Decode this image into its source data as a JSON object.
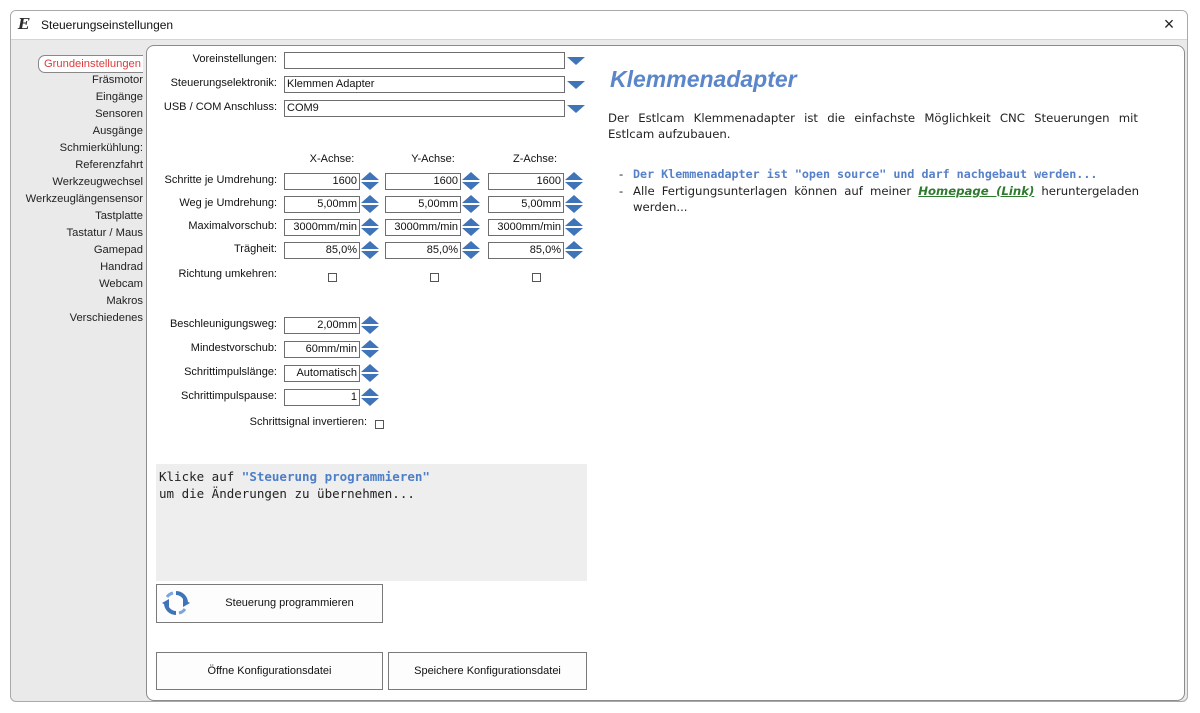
{
  "window": {
    "title": "Steuerungseinstellungen",
    "close_label": "×"
  },
  "sidebar": {
    "items": [
      {
        "label": "Grundeinstellungen",
        "active": true
      },
      {
        "label": "Fräsmotor"
      },
      {
        "label": "Eingänge"
      },
      {
        "label": "Sensoren"
      },
      {
        "label": "Ausgänge"
      },
      {
        "label": "Schmierkühlung:"
      },
      {
        "label": "Referenzfahrt"
      },
      {
        "label": "Werkzeugwechsel"
      },
      {
        "label": "Werkzeuglängensensor"
      },
      {
        "label": "Tastplatte"
      },
      {
        "label": "Tastatur / Maus"
      },
      {
        "label": "Gamepad"
      },
      {
        "label": "Handrad"
      },
      {
        "label": "Webcam"
      },
      {
        "label": "Makros"
      },
      {
        "label": "Verschiedenes"
      }
    ]
  },
  "top": {
    "voreinstellungen_label": "Voreinstellungen:",
    "voreinstellungen_value": "",
    "elektronik_label": "Steuerungselektronik:",
    "elektronik_value": "Klemmen Adapter",
    "usb_label": "USB / COM Anschluss:",
    "usb_value": "COM9"
  },
  "axes": {
    "headers": [
      "X-Achse:",
      "Y-Achse:",
      "Z-Achse:"
    ],
    "rows": [
      {
        "label": "Schritte je Umdrehung:",
        "values": [
          "1600",
          "1600",
          "1600"
        ]
      },
      {
        "label": "Weg je Umdrehung:",
        "values": [
          "5,00mm",
          "5,00mm",
          "5,00mm"
        ]
      },
      {
        "label": "Maximalvorschub:",
        "values": [
          "3000mm/min",
          "3000mm/min",
          "3000mm/min"
        ]
      },
      {
        "label": "Trägheit:",
        "values": [
          "85,0%",
          "85,0%",
          "85,0%"
        ]
      }
    ],
    "richtung_label": "Richtung umkehren:"
  },
  "extra": {
    "beschleunigung_label": "Beschleunigungsweg:",
    "beschleunigung_value": "2,00mm",
    "mindestvorschub_label": "Mindestvorschub:",
    "mindestvorschub_value": "60mm/min",
    "impulslaenge_label": "Schrittimpulslänge:",
    "impulslaenge_value": "Automatisch",
    "impulspause_label": "Schrittimpulspause:",
    "impulspause_value": "1",
    "invertieren_label": "Schrittsignal invertieren:"
  },
  "info": {
    "line1_prefix": "Klicke auf ",
    "line1_highlight": "\"Steuerung programmieren\"",
    "line2": "um die Änderungen zu übernehmen..."
  },
  "buttons": {
    "program": "Steuerung programmieren",
    "open_config": "Öffne Konfigurationsdatei",
    "save_config": "Speichere Konfigurationsdatei"
  },
  "help": {
    "heading": "Klemmenadapter",
    "description": "Der Estlcam Klemmenadapter ist die einfachste Möglichkeit CNC Steuerungen mit Estlcam aufzubauen.",
    "bullet_dash": "-",
    "bullet1": "Der Klemmenadapter ist \"open source\" und darf nachgebaut werden...",
    "bullet2_before": "Alle Fertigungsunterlagen können auf meiner ",
    "bullet2_link": "Homepage (Link)",
    "bullet2_after": " heruntergeladen werden..."
  },
  "colors": {
    "accent": "#3f74b9",
    "heading": "#5b86c9",
    "active_sidebar": "#e03a3a",
    "link": "#2f7a2f"
  }
}
